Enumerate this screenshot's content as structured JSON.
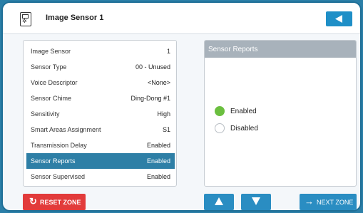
{
  "header": {
    "title": "Image Sensor 1",
    "device_icon": "sensor-device-icon",
    "back_icon": "triangle-left-icon"
  },
  "settings": {
    "rows": [
      {
        "label": "Image Sensor",
        "value": "1"
      },
      {
        "label": "Sensor Type",
        "value": "00 - Unused"
      },
      {
        "label": "Voice Descriptor",
        "value": "<None>"
      },
      {
        "label": "Sensor Chime",
        "value": "Ding-Dong #1"
      },
      {
        "label": "Sensitivity",
        "value": "High"
      },
      {
        "label": "Smart Areas Assignment",
        "value": "S1"
      },
      {
        "label": "Transmission Delay",
        "value": "Enabled"
      },
      {
        "label": "Sensor Reports",
        "value": "Enabled"
      },
      {
        "label": "Sensor Supervised",
        "value": "Enabled"
      }
    ],
    "selected_index": 7
  },
  "report": {
    "title": "Sensor Reports",
    "options": [
      {
        "label": "Enabled",
        "selected": true
      },
      {
        "label": "Disabled",
        "selected": false
      }
    ]
  },
  "footer": {
    "reset_label": "RESET ZONE",
    "next_label": "NEXT ZONE",
    "reset_icon": "refresh-icon",
    "next_icon": "arrow-right-icon"
  },
  "colors": {
    "accent": "#2a8dc2",
    "selected_row": "#2e7fa6",
    "reset": "#e23b3b",
    "enabled_dot": "#6bbf3f"
  }
}
